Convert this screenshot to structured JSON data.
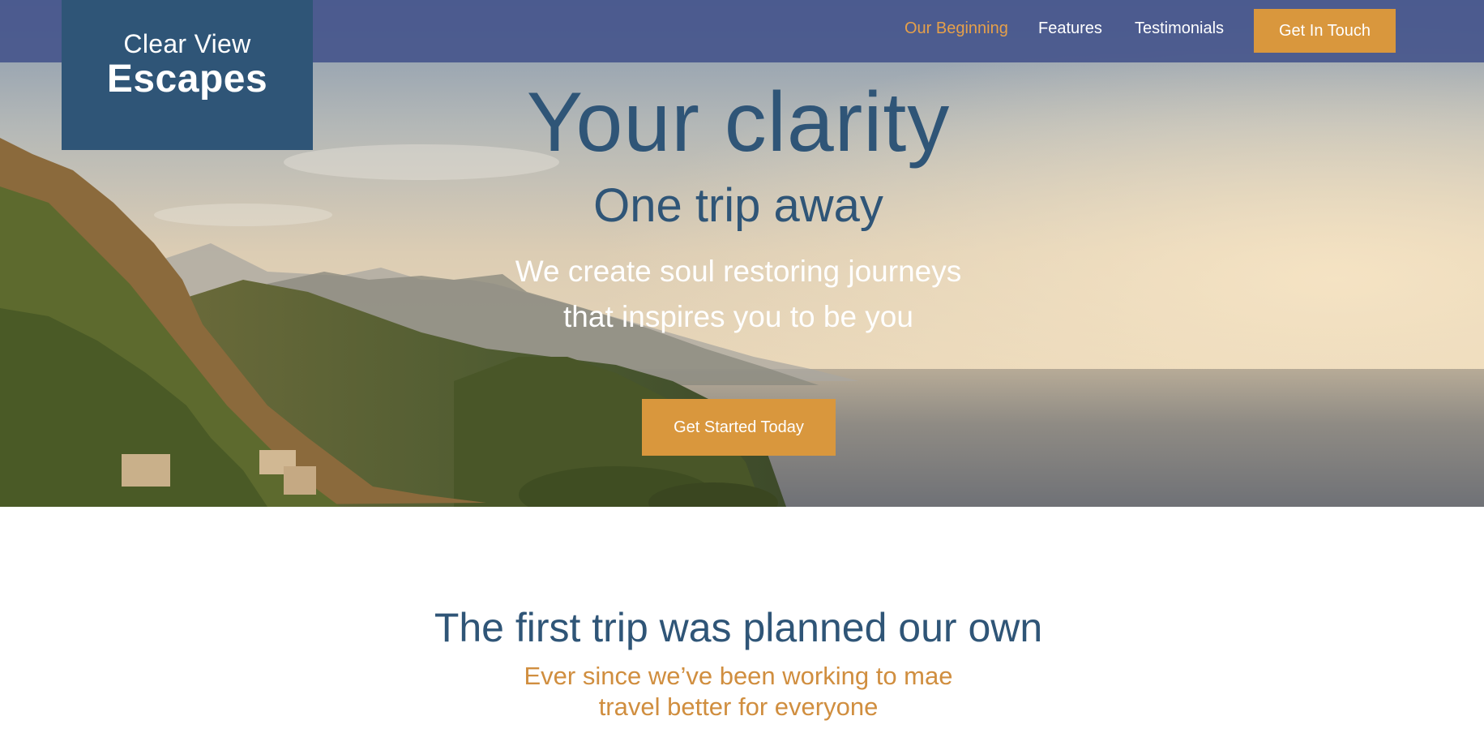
{
  "brand": {
    "line1": "Clear View",
    "line2": "Escapes"
  },
  "nav": {
    "items": [
      {
        "label": "Our Beginning",
        "active": true
      },
      {
        "label": "Features",
        "active": false
      },
      {
        "label": "Testimonials",
        "active": false
      }
    ],
    "cta_label": "Get In Touch"
  },
  "hero": {
    "title": "Your clarity",
    "subtitle": "One trip away",
    "description": "We create soul restoring journeys that inspires you to be you",
    "cta_label": "Get Started Today",
    "image": "coastal-mountains-sea-sunset"
  },
  "intro": {
    "title": "The first trip was planned our own",
    "subtitle_line1": "Ever since we’ve been working to mae",
    "subtitle_line2": "travel better for everyone"
  },
  "colors": {
    "navy": "#2f5577",
    "nav_bg": "#46568c",
    "accent": "#d9973d",
    "accent_text": "#d08e3f"
  }
}
